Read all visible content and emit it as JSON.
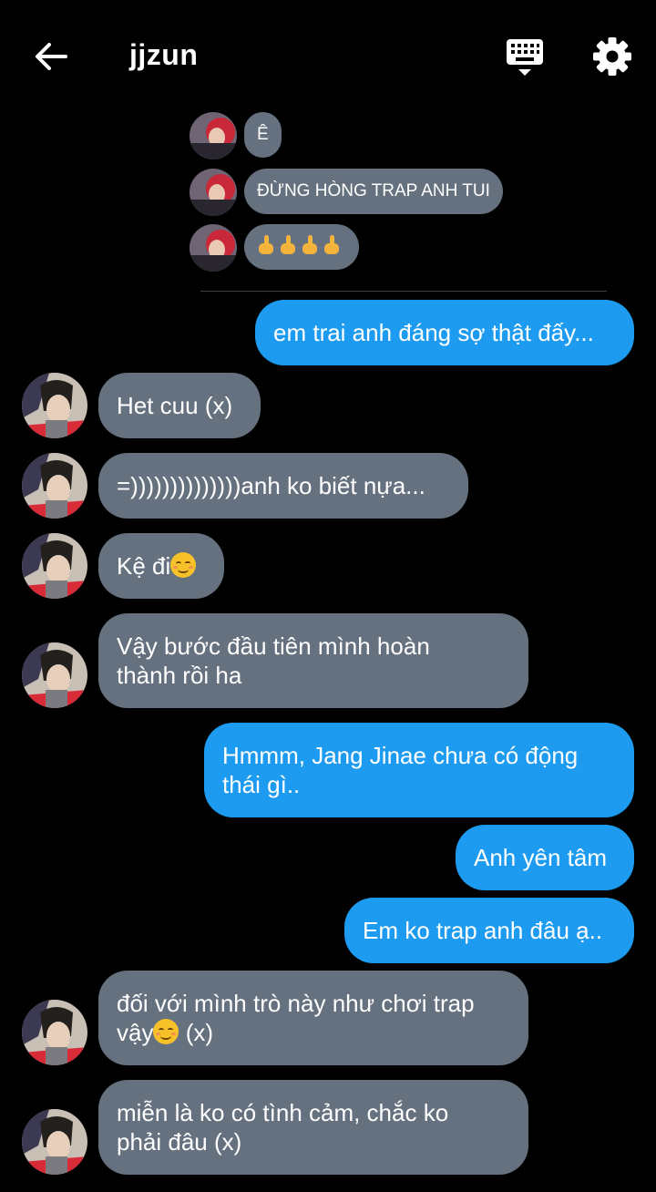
{
  "header": {
    "title": "jjzun",
    "back_icon": "arrow-left-icon",
    "keyboard_icon": "keyboard-icon",
    "settings_icon": "gear-icon"
  },
  "colors": {
    "background": "#000000",
    "sent_bubble": "#1c9bf0",
    "received_bubble": "#65717f"
  },
  "quoted": [
    {
      "text": "Ê"
    },
    {
      "text": "ĐỪNG HÒNG TRAP ANH TUI"
    },
    {
      "text": "🖕🖕🖕🖕"
    }
  ],
  "messages": [
    {
      "side": "sent",
      "text": "em trai anh đáng sợ thật đấy..."
    },
    {
      "side": "received",
      "text": "Het cuu (x)"
    },
    {
      "side": "received",
      "text": "=))))))))))))))anh ko biết nựa..."
    },
    {
      "side": "received",
      "text": "Kệ đi",
      "emoji": "smiling-face-icon"
    },
    {
      "side": "received",
      "line1": "Vậy bước đầu tiên mình hoàn",
      "line2": "thành rồi ha"
    },
    {
      "side": "sent",
      "line1": "Hmmm, Jang Jinae chưa có động",
      "line2": "thái gì.."
    },
    {
      "side": "sent",
      "text": "Anh yên tâm"
    },
    {
      "side": "sent",
      "text": "Em ko trap anh đâu ạ.."
    },
    {
      "side": "received",
      "line1": "đối với mình trò này như chơi trap",
      "line2a": "vậy",
      "line2b": " (x)",
      "emoji": "smiling-face-icon"
    },
    {
      "side": "received",
      "line1": "miễn là ko có tình cảm, chắc ko",
      "line2": "phải đâu (x)"
    }
  ]
}
